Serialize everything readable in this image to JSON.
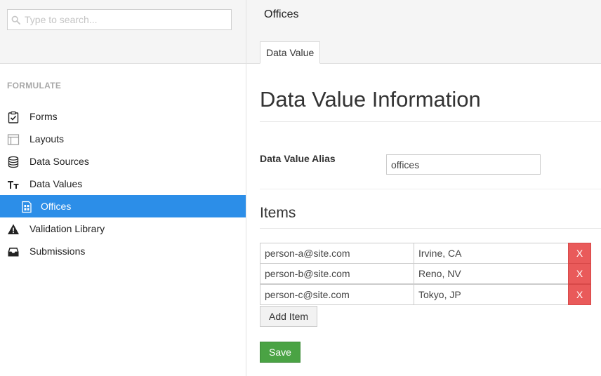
{
  "search": {
    "placeholder": "Type to search...",
    "value": "",
    "icon": "search-icon"
  },
  "sidebar": {
    "section_title": "FORMULATE",
    "items": [
      {
        "label": "Forms",
        "icon": "clipboard-check-icon"
      },
      {
        "label": "Layouts",
        "icon": "layout-icon"
      },
      {
        "label": "Data Sources",
        "icon": "database-icon"
      },
      {
        "label": "Data Values",
        "icon": "text-size-icon"
      },
      {
        "label": "Offices",
        "icon": "data-value-file-icon",
        "active": true,
        "child": true
      },
      {
        "label": "Validation Library",
        "icon": "warning-icon"
      },
      {
        "label": "Submissions",
        "icon": "inbox-icon"
      }
    ],
    "active_color": "#2c8ee8"
  },
  "main": {
    "title": "Offices",
    "tab": "Data Value",
    "heading": "Data Value Information",
    "alias_label": "Data Value Alias",
    "alias_value": "offices",
    "items_heading": "Items",
    "items": [
      {
        "email": "person-a@site.com",
        "office": "Irvine, CA",
        "delete_label": "X"
      },
      {
        "email": "person-b@site.com",
        "office": "Reno, NV",
        "delete_label": "X"
      },
      {
        "email": "person-c@site.com",
        "office": "Tokyo, JP",
        "delete_label": "X"
      }
    ],
    "add_item_label": "Add Item",
    "save_label": "Save"
  },
  "colors": {
    "delete": "#e95a5a",
    "save": "#4aa344"
  }
}
